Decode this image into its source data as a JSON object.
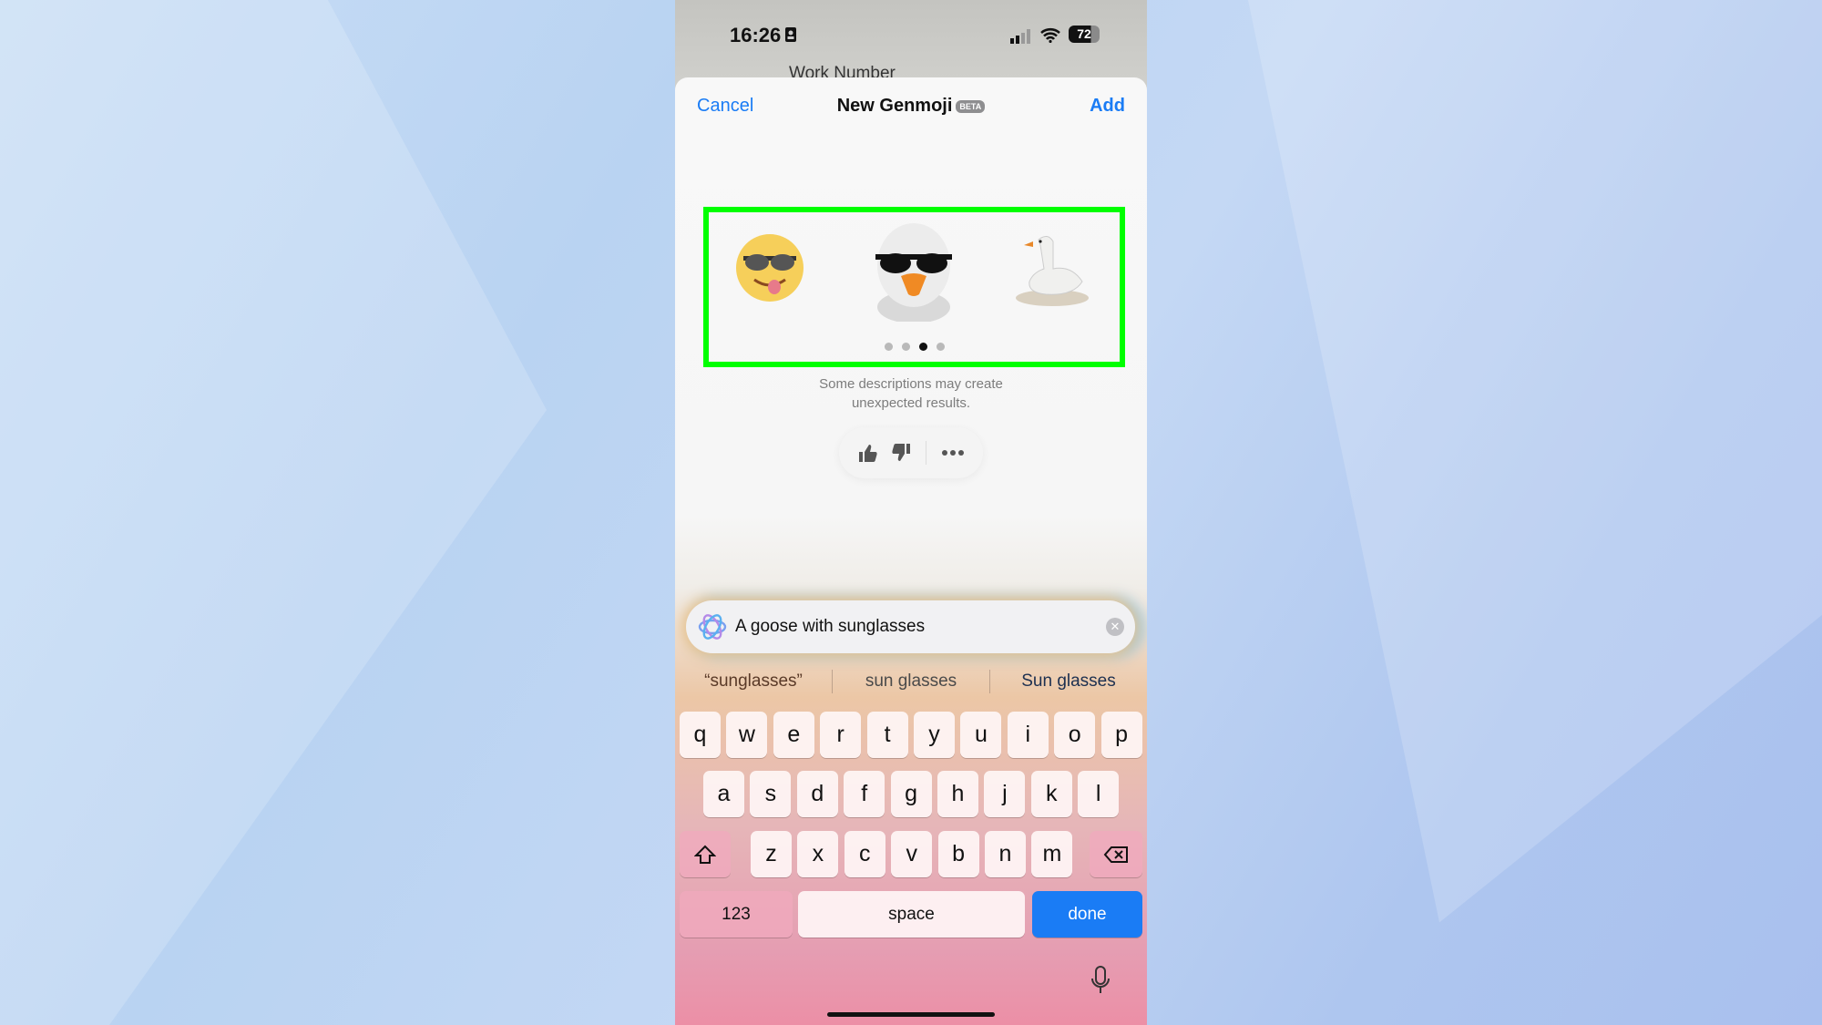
{
  "status": {
    "time": "16:26",
    "battery": "72",
    "behind_title": "Work Number"
  },
  "nav": {
    "cancel": "Cancel",
    "title": "New Genmoji",
    "badge": "BETA",
    "add": "Add"
  },
  "carousel": {
    "items": [
      "sunglasses-smiley-emoji",
      "goose-with-sunglasses-genmoji",
      "goose-genmoji"
    ],
    "page_count": 4,
    "current_page": 3,
    "highlight_color": "#00ff00"
  },
  "caption": {
    "line1": "Some descriptions may create",
    "line2": "unexpected results."
  },
  "feedback": {
    "icons": [
      "thumbs-up-icon",
      "thumbs-down-icon",
      "more-icon"
    ]
  },
  "input": {
    "value": "A goose with sunglasses"
  },
  "suggestions": [
    "“sunglasses”",
    "sun glasses",
    "Sun glasses"
  ],
  "keyboard": {
    "row1": [
      "q",
      "w",
      "e",
      "r",
      "t",
      "y",
      "u",
      "i",
      "o",
      "p"
    ],
    "row2": [
      "a",
      "s",
      "d",
      "f",
      "g",
      "h",
      "j",
      "k",
      "l"
    ],
    "row3": [
      "z",
      "x",
      "c",
      "v",
      "b",
      "n",
      "m"
    ],
    "numbers": "123",
    "space": "space",
    "done": "done"
  },
  "colors": {
    "accent": "#1a7cf5"
  }
}
